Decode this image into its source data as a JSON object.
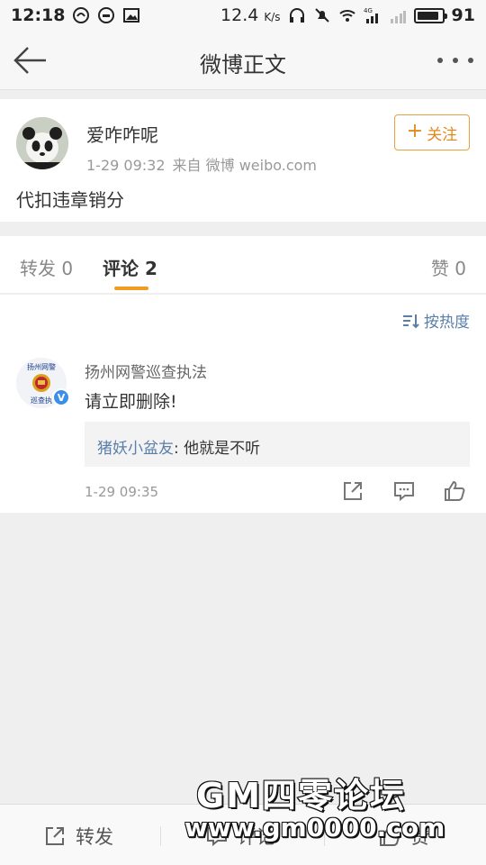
{
  "status_bar": {
    "time": "12:18",
    "net_speed": "12.4",
    "net_unit": "K/s",
    "network_type": "4G",
    "battery": "91",
    "battery_level": 0.91,
    "icons": [
      "weibo-notify-icon",
      "dot-circle-icon",
      "image-icon",
      "headphones-icon",
      "mute-icon",
      "wifi-icon",
      "signal-4g-icon",
      "signal-icon",
      "battery-icon"
    ]
  },
  "nav": {
    "title": "微博正文",
    "back_icon": "arrow-left-icon",
    "more_icon": "more-dots-icon"
  },
  "post": {
    "author": "爱咋咋呢",
    "time": "1-29 09:32",
    "source": "来自 微博 weibo.com",
    "follow_label": "关注",
    "text": "代扣违章销分"
  },
  "tabs": {
    "repost": "转发 0",
    "comment": "评论 2",
    "like": "赞 0",
    "active": "comment",
    "accent_color": "#f29c1f"
  },
  "comments": {
    "sort_label": "按热度",
    "items": [
      {
        "avatar_text_top": "扬州网警",
        "avatar_text_bottom": "巡查执",
        "author": "扬州网警巡查执法",
        "verified": true,
        "text": "请立即删除!",
        "reply_user": "猪妖小盆友",
        "reply_text": ": 他就是不听",
        "time": "1-29 09:35"
      }
    ]
  },
  "bottom_bar": {
    "repost_label": "转发",
    "comment_label": "评论",
    "like_label": "赞"
  },
  "watermark": {
    "title": "GM四零论坛",
    "url": "www.gm0000.com"
  },
  "colors": {
    "link_blue": "#5a7fa8",
    "follow_orange": "#e08a1e",
    "verified_blue": "#3b8fe6"
  }
}
